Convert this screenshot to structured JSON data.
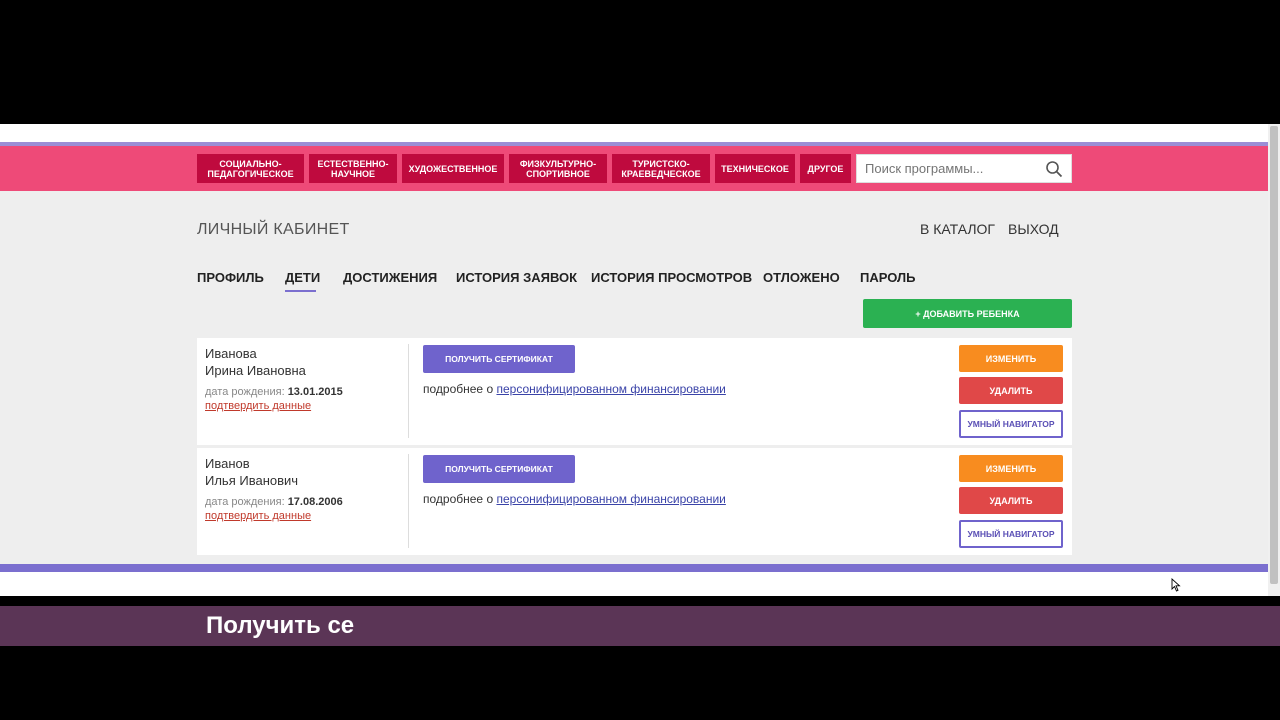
{
  "categories": [
    {
      "label": "Социально-педагогическое"
    },
    {
      "label": "Естественно-научное"
    },
    {
      "label": "Художественное"
    },
    {
      "label": "Физкультурно-спортивное"
    },
    {
      "label": "Туристско-краеведческое"
    },
    {
      "label": "Техническое"
    },
    {
      "label": "Другое"
    }
  ],
  "search": {
    "placeholder": "Поиск программы..."
  },
  "header": {
    "title": "ЛИЧНЫЙ КАБИНЕТ",
    "catalog": "В КАТАЛОГ",
    "logout": "ВЫХОД"
  },
  "tabs": [
    "ПРОФИЛЬ",
    "ДЕТИ",
    "ДОСТИЖЕНИЯ",
    "ИСТОРИЯ ЗАЯВОК",
    "ИСТОРИЯ ПРОСМОТРОВ",
    "ОТЛОЖЕНО",
    "ПАРОЛЬ"
  ],
  "active_tab": "ДЕТИ",
  "add_child_label": "+ ДОБАВИТЬ РЕБЕНКА",
  "children": [
    {
      "surname": "Иванова",
      "name": "Ирина Ивановна",
      "dob_label": "дата рождения:",
      "dob": "13.01.2015",
      "confirm": "подтвердить данные",
      "cert": "ПОЛУЧИТЬ СЕРТИФИКАТ",
      "more_prefix": "подробнее о",
      "more_link": "персонифицированном финансировании",
      "edit": "ИЗМЕНИТЬ",
      "delete": "УДАЛИТЬ",
      "navigator": "УМНЫЙ НАВИГАТОР"
    },
    {
      "surname": "Иванов",
      "name": "Илья Иванович",
      "dob_label": "дата рождения:",
      "dob": "17.08.2006",
      "confirm": "подтвердить данные",
      "cert": "ПОЛУЧИТЬ СЕРТИФИКАТ",
      "more_prefix": "подробнее о",
      "more_link": "персонифицированном финансировании",
      "edit": "ИЗМЕНИТЬ",
      "delete": "УДАЛИТЬ",
      "navigator": "УМНЫЙ НАВИГАТОР"
    }
  ],
  "caption": "Получить се",
  "colors": {
    "pink": "#ee4a78",
    "category": "#bf0a3e",
    "purple": "#6f63cc",
    "green": "#2bb152",
    "orange": "#f88c1f",
    "red": "#e04848",
    "caption_bg": "#5b3556"
  }
}
